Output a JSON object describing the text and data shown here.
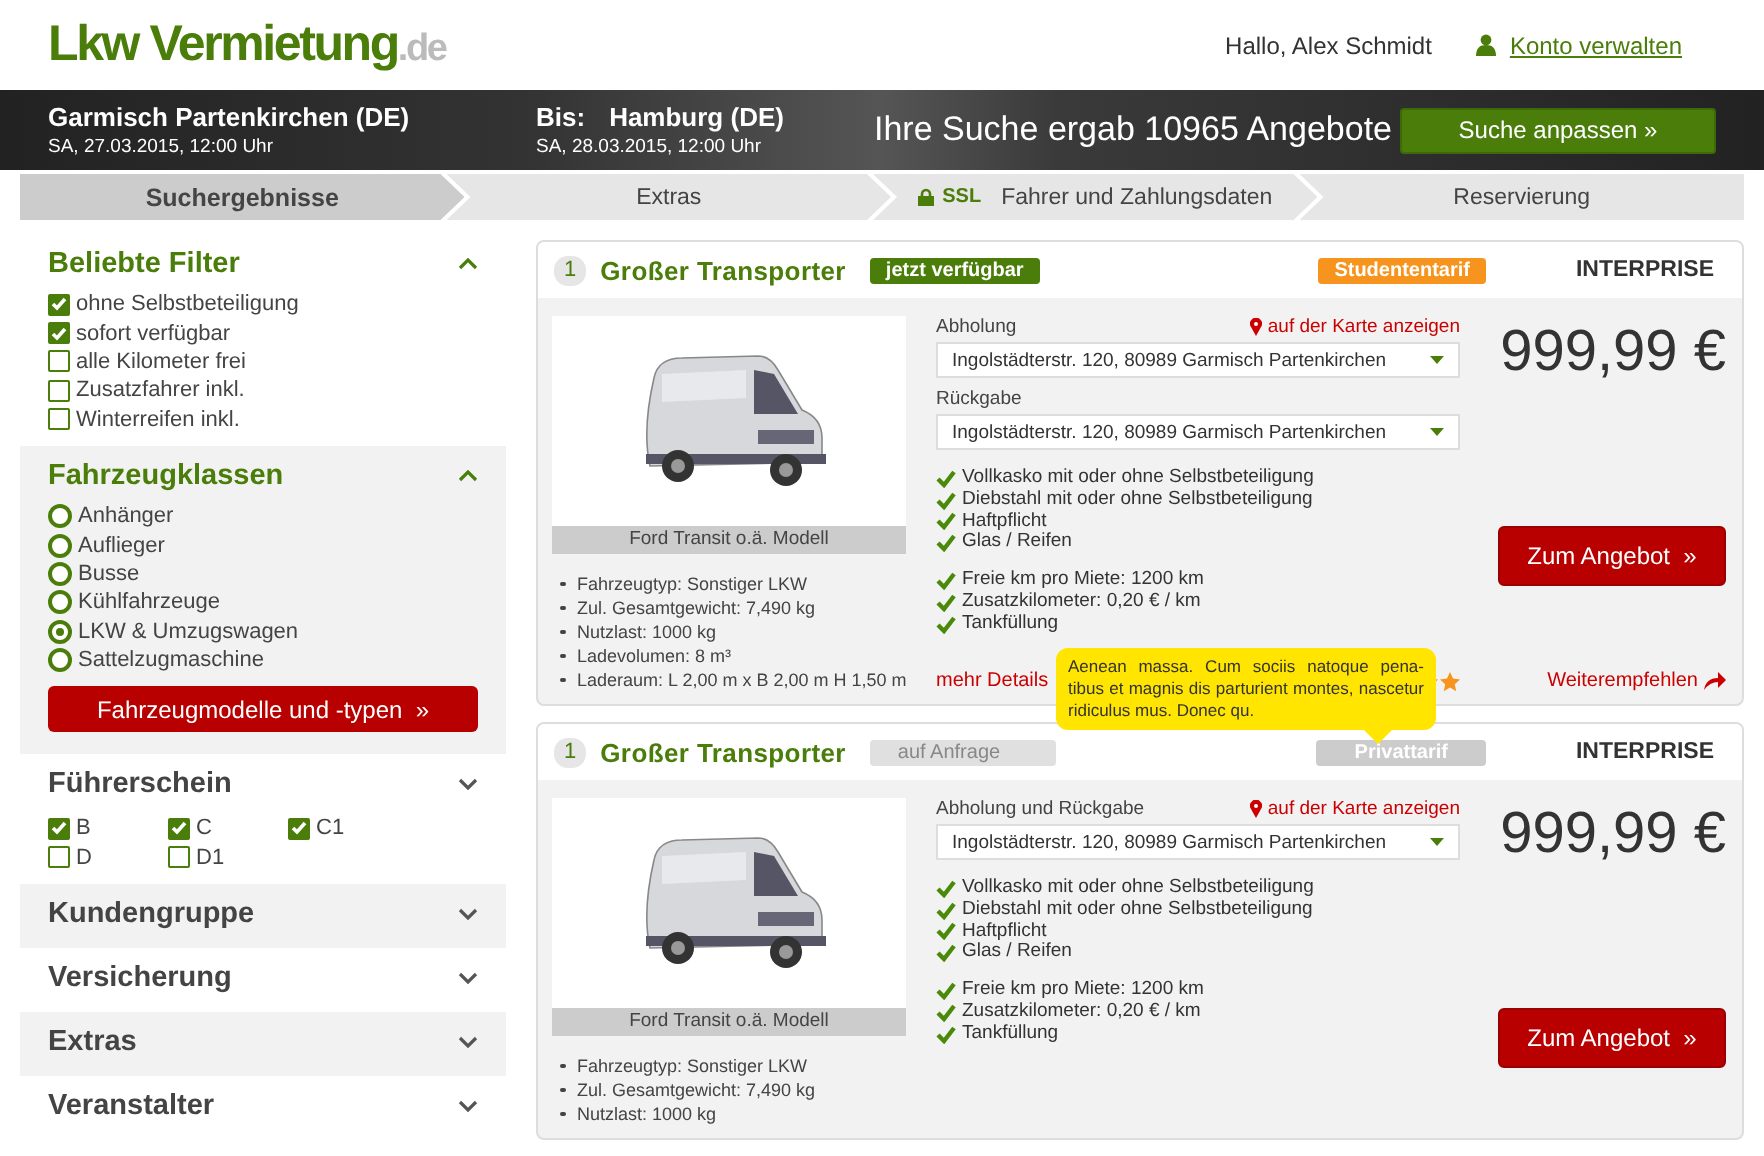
{
  "header": {
    "logo": {
      "main": "Lkw Vermietung",
      "tld": ".de"
    },
    "greeting": "Hallo, Alex Schmidt",
    "account_link": "Konto verwalten"
  },
  "banner": {
    "from": {
      "city": "Garmisch Partenkirchen (DE)",
      "date": "SA, 27.03.2015, 12:00 Uhr"
    },
    "to": {
      "label": "Bis:",
      "city": "Hamburg (DE)",
      "date": "SA, 28.03.2015, 12:00 Uhr"
    },
    "result": "Ihre Suche ergab 10965 Angebote",
    "button": "Suche anpassen »"
  },
  "steps": [
    {
      "label": "Suchergebnisse",
      "selected": true
    },
    {
      "label": "Extras",
      "selected": false
    },
    {
      "label": "Fahrer und Zahlungsdaten",
      "selected": false,
      "badge": "SSL"
    },
    {
      "label": "Reservierung",
      "selected": false
    }
  ],
  "sidebar": {
    "sections": [
      {
        "title": "Beliebte Filter",
        "kind": "checklist",
        "expanded": true,
        "items": [
          {
            "label": "ohne Selbstbeteiligung",
            "checked": true
          },
          {
            "label": "sofort verfügbar",
            "checked": true
          },
          {
            "label": "alle Kilometer frei",
            "checked": false
          },
          {
            "label": "Zusatzfahrer inkl.",
            "checked": false
          },
          {
            "label": "Winterreifen inkl.",
            "checked": false
          }
        ]
      },
      {
        "title": "Fahrzeugklassen",
        "kind": "radiolist",
        "expanded": true,
        "items": [
          {
            "label": "Anhänger",
            "selected": false
          },
          {
            "label": "Auflieger",
            "selected": false
          },
          {
            "label": "Busse",
            "selected": false
          },
          {
            "label": "Kühlfahrzeuge",
            "selected": false
          },
          {
            "label": "LKW & Umzugswagen",
            "selected": true
          },
          {
            "label": "Sattelzugmaschine",
            "selected": false
          }
        ],
        "button": "Fahrzeugmodelle und -typen  »"
      },
      {
        "title": "Führerschein",
        "kind": "checkgrid",
        "expanded": false,
        "items": [
          {
            "label": "B",
            "checked": true
          },
          {
            "label": "C",
            "checked": true
          },
          {
            "label": "C1",
            "checked": true
          },
          {
            "label": "D",
            "checked": false
          },
          {
            "label": "D1",
            "checked": false
          }
        ]
      },
      {
        "title": "Kundengruppe",
        "kind": "closed",
        "expanded": false
      },
      {
        "title": "Versicherung",
        "kind": "closed",
        "expanded": false
      },
      {
        "title": "Extras",
        "kind": "closed",
        "expanded": false
      },
      {
        "title": "Veranstalter",
        "kind": "closed",
        "expanded": false
      }
    ]
  },
  "offers": [
    {
      "number": "1",
      "title": "Großer Transporter",
      "availability": {
        "label": "jetzt verfügbar",
        "kind": "available"
      },
      "tariff": {
        "label": "Studententarif",
        "kind": "student"
      },
      "provider": "INTERPRISE",
      "image_caption": "Ford Transit o.ä. Modell",
      "specs": [
        "Fahrzeugtyp: Sonstiger LKW",
        "Zul. Gesamtgewicht: 7,490 kg",
        "Nutzlast: 1000 kg",
        "Ladevolumen: 8 m³",
        "Laderaum: L 2,00 m x B 2,00 m H 1,50 m"
      ],
      "map_link": "auf der Karte anzeigen",
      "locations": [
        {
          "label": "Abholung",
          "value": "Ingolstädterstr. 120, 80989 Garmisch Partenkirchen"
        },
        {
          "label": "Rückgabe",
          "value": "Ingolstädterstr. 120, 80989 Garmisch Partenkirchen"
        }
      ],
      "insurance": [
        "Vollkasko mit oder ohne Selbstbeteiligung",
        "Diebstahl mit oder ohne Selbstbeteiligung",
        "Haftpflicht",
        "Glas / Reifen"
      ],
      "extras": [
        "Freie km pro Miete: 1200 km",
        "Zusatzkilometer: 0,20 € / km",
        "Tankfüllung"
      ],
      "price": "999,99 €",
      "button": "Zum Angebot  »",
      "more_details": "mehr Details",
      "recommend": "Weiterempfehlen"
    },
    {
      "number": "1",
      "title": "Großer Transporter",
      "availability": {
        "label": "auf Anfrage",
        "kind": "request"
      },
      "tariff": {
        "label": "Privattarif",
        "kind": "private"
      },
      "provider": "INTERPRISE",
      "image_caption": "Ford Transit o.ä. Modell",
      "specs": [
        "Fahrzeugtyp: Sonstiger LKW",
        "Zul. Gesamtgewicht: 7,490 kg",
        "Nutzlast: 1000 kg"
      ],
      "map_link": "auf der Karte anzeigen",
      "locations": [
        {
          "label": "Abholung und Rückgabe",
          "value": "Ingolstädterstr. 120, 80989 Garmisch Partenkirchen"
        }
      ],
      "insurance": [
        "Vollkasko mit oder ohne Selbstbeteiligung",
        "Diebstahl mit oder ohne Selbstbeteiligung",
        "Haftpflicht",
        "Glas / Reifen"
      ],
      "extras": [
        "Freie km pro Miete: 1200 km",
        "Zusatzkilometer: 0,20 € / km",
        "Tankfüllung"
      ],
      "price": "999,99 €",
      "button": "Zum Angebot  »"
    }
  ],
  "tooltip": "Aenean massa. Cum sociis natoque pena-tibus et magnis dis parturient montes, nascetur ridiculus mus. Donec qu."
}
